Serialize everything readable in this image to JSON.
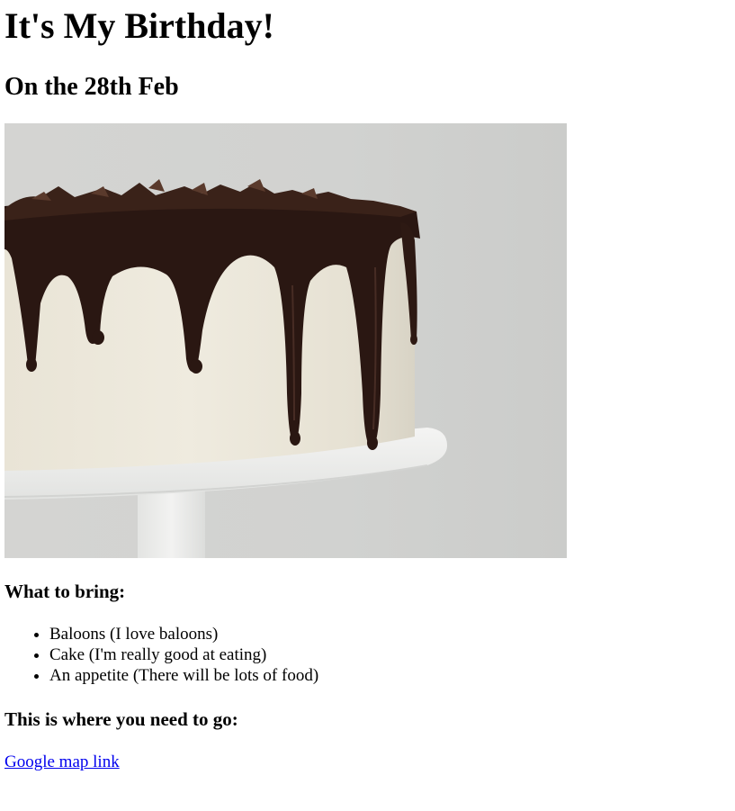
{
  "page": {
    "title": "It's My Birthday!",
    "date_heading": "On the 28th Feb",
    "bring_heading": "What to bring:",
    "bring_items": [
      "Baloons (I love baloons)",
      "Cake (I'm really good at eating)",
      "An appetite (There will be lots of food)"
    ],
    "go_heading": "This is where you need to go:",
    "map_link_label": "Google map link"
  },
  "colors": {
    "link": "#0000ee",
    "text": "#000000",
    "background": "#ffffff"
  }
}
